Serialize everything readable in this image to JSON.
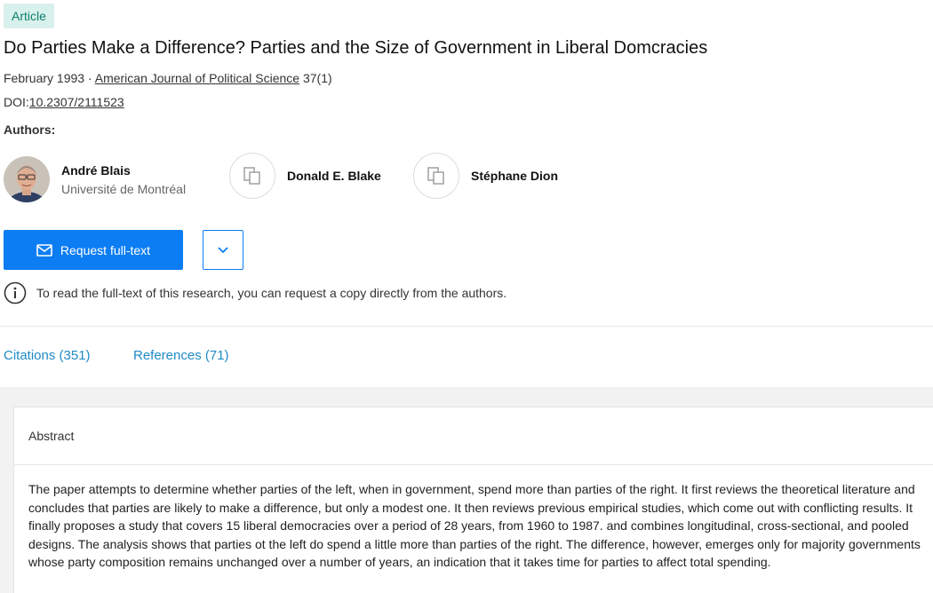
{
  "article": {
    "badge": "Article",
    "title": "Do Parties Make a Difference? Parties and the Size of Government in Liberal Domcracies",
    "date": "February 1993",
    "separator": " · ",
    "journal": "American Journal of Political Science",
    "volume": " 37(1)",
    "doi_label": "DOI:",
    "doi_value": "10.2307/2111523"
  },
  "authors": {
    "label": "Authors:",
    "list": [
      {
        "name": "André Blais",
        "institution": "Université de Montréal",
        "avatar": "photo"
      },
      {
        "name": "Donald E. Blake",
        "institution": "",
        "avatar": "placeholder-icon"
      },
      {
        "name": "Stéphane Dion",
        "institution": "",
        "avatar": "placeholder-icon"
      }
    ]
  },
  "actions": {
    "request_label": "Request full-text",
    "request_icon": "envelope-icon",
    "dropdown_icon": "chevron-down-icon",
    "info_icon": "info-icon",
    "info_text": "To read the full-text of this research, you can request a copy directly from the authors."
  },
  "tabs": [
    {
      "label": "Citations (351)"
    },
    {
      "label": "References (71)"
    }
  ],
  "abstract": {
    "label": "Abstract",
    "text": "The paper attempts to determine whether parties of the left, when in government, spend more than parties of the right. It first reviews the theoretical literature and concludes that parties are likely to make a difference, but only a modest one. It then reviews previous empirical studies, which come out with conflicting results. It finally proposes a study that covers 15 liberal democracies over a period of 28 years, from 1960 to 1987. and combines longitudinal, cross-sectional, and pooled designs. The analysis shows that parties ot the left do spend a little more than parties of the right. The difference, however, emerges only for majority governments whose party composition remains unchanged over a number of years, an indication that it takes time for parties to affect total spending."
  },
  "colors": {
    "primary": "#0c7df2",
    "link": "#1f8bc7",
    "badge_bg": "#d9f1ec",
    "badge_text": "#0d7f6d"
  }
}
